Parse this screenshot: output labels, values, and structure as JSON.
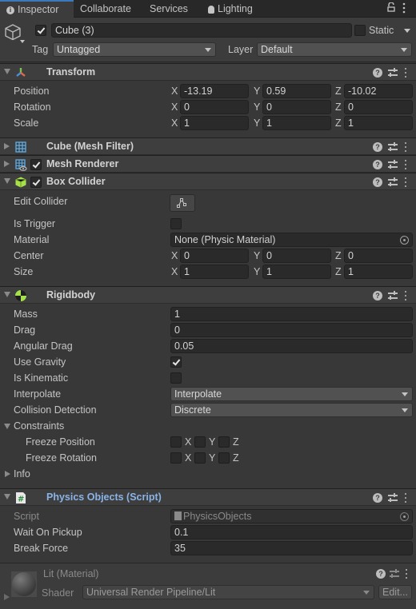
{
  "tabs": [
    {
      "label": "Inspector",
      "icon": "info-icon",
      "active": true
    },
    {
      "label": "Collaborate"
    },
    {
      "label": "Services"
    },
    {
      "label": "Lighting",
      "icon": "lightbulb-icon"
    }
  ],
  "gameobject": {
    "active": true,
    "name": "Cube (3)",
    "static_label": "Static",
    "static": false,
    "tag_label": "Tag",
    "tag": "Untagged",
    "layer_label": "Layer",
    "layer": "Default"
  },
  "transform": {
    "title": "Transform",
    "rows": [
      {
        "label": "Position",
        "x": "-13.19",
        "y": "0.59",
        "z": "-10.02"
      },
      {
        "label": "Rotation",
        "x": "0",
        "y": "0",
        "z": "0"
      },
      {
        "label": "Scale",
        "x": "1",
        "y": "1",
        "z": "1"
      }
    ]
  },
  "axes": {
    "x": "X",
    "y": "Y",
    "z": "Z"
  },
  "mesh_filter": {
    "title": "Cube (Mesh Filter)"
  },
  "mesh_renderer": {
    "title": "Mesh Renderer",
    "enabled": true
  },
  "box_collider": {
    "title": "Box Collider",
    "enabled": true,
    "edit_collider_label": "Edit Collider",
    "is_trigger_label": "Is Trigger",
    "is_trigger": false,
    "material_label": "Material",
    "material": "None (Physic Material)",
    "center_label": "Center",
    "center": {
      "x": "0",
      "y": "0",
      "z": "0"
    },
    "size_label": "Size",
    "size": {
      "x": "1",
      "y": "1",
      "z": "1"
    }
  },
  "rigidbody": {
    "title": "Rigidbody",
    "mass_label": "Mass",
    "mass": "1",
    "drag_label": "Drag",
    "drag": "0",
    "angular_drag_label": "Angular Drag",
    "angular_drag": "0.05",
    "use_gravity_label": "Use Gravity",
    "use_gravity": true,
    "is_kinematic_label": "Is Kinematic",
    "is_kinematic": false,
    "interpolate_label": "Interpolate",
    "interpolate": "Interpolate",
    "collision_label": "Collision Detection",
    "collision": "Discrete",
    "constraints_label": "Constraints",
    "freeze_position_label": "Freeze Position",
    "freeze_rotation_label": "Freeze Rotation",
    "info_label": "Info"
  },
  "script": {
    "title": "Physics Objects (Script)",
    "script_label": "Script",
    "script_value": "PhysicsObjects",
    "wait_label": "Wait On Pickup",
    "wait": "0.1",
    "break_label": "Break Force",
    "break": "35"
  },
  "material": {
    "title": "Lit (Material)",
    "shader_label": "Shader",
    "shader": "Universal Render Pipeline/Lit",
    "edit_label": "Edit..."
  },
  "colors": {
    "accent": "#3a79bb",
    "script_title": "#8ab4e8",
    "collider_green": "#a6e04b"
  }
}
